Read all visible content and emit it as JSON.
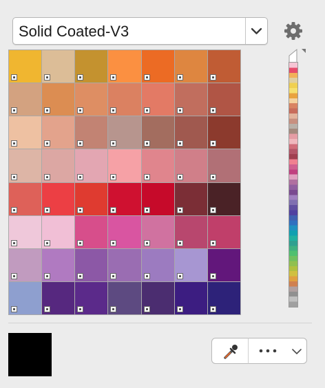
{
  "palette_select": {
    "value": "Solid Coated-V3"
  },
  "icons": {
    "dropdown": "chevron-down-icon",
    "settings": "gear-icon",
    "eyedropper": "eyedropper-icon",
    "more": "more-dots-icon",
    "more_dropdown": "chevron-down-icon"
  },
  "swatches": [
    "#f0b630",
    "#dcbd97",
    "#c4922f",
    "#fb9041",
    "#ec6b24",
    "#de8640",
    "#c05c34",
    "#d3a280",
    "#dc8d52",
    "#de8e63",
    "#db8161",
    "#e37a65",
    "#c16e5e",
    "#b05545",
    "#eec1a2",
    "#e3a38c",
    "#c28373",
    "#b7958e",
    "#a36d5f",
    "#a0594f",
    "#8c3a2d",
    "#ddb5a6",
    "#dca7a3",
    "#e3a6b2",
    "#f6a1a6",
    "#e0858d",
    "#d07f89",
    "#b17076",
    "#de6159",
    "#ec3f44",
    "#df3b30",
    "#cf1130",
    "#c60a2a",
    "#7b2e36",
    "#4a2226",
    "#efc8da",
    "#f1bfd6",
    "#d74e8b",
    "#d955a1",
    "#d072a0",
    "#b8476e",
    "#c03f6a",
    "#c19bbf",
    "#b07ac1",
    "#8c58a6",
    "#9a6db2",
    "#9c7bc0",
    "#a796d2",
    "#62177b",
    "#8e9fcf",
    "#56287f",
    "#5b2a8a",
    "#5d4a81",
    "#4b2d70",
    "#3c1d81",
    "#2d2279"
  ],
  "strip_colors": [
    "#f6c5d4",
    "#e64c6b",
    "#f2b15a",
    "#e0d0a0",
    "#f0d050",
    "#f5e070",
    "#e9a33f",
    "#f4d2a0",
    "#d98463",
    "#c86d5c",
    "#e3b49d",
    "#c89080",
    "#b9b0a8",
    "#a58a7e",
    "#e59da5",
    "#f0b8bd",
    "#d16e7a",
    "#b45668",
    "#a04050",
    "#f08090",
    "#d06090",
    "#c04080",
    "#e0a0c0",
    "#b070a0",
    "#9060a0",
    "#7a4a90",
    "#a080c0",
    "#8070b0",
    "#6050a0",
    "#5040a0",
    "#4060b0",
    "#3070c0",
    "#2090c0",
    "#10a0b0",
    "#20b0a0",
    "#30a090",
    "#40b080",
    "#50c070",
    "#70c060",
    "#90c050",
    "#b0c040",
    "#d0c040",
    "#e0a040",
    "#d08050",
    "#b0a0a0",
    "#909090",
    "#c0c0c0",
    "#a0a0a0"
  ],
  "current_color": "#000000"
}
